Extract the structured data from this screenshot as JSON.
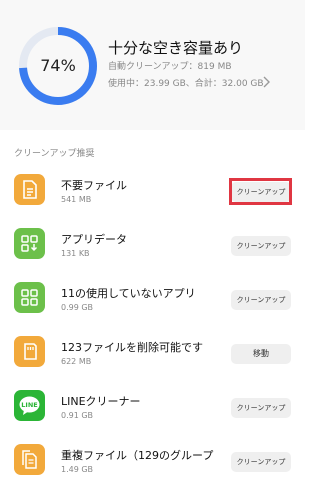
{
  "storage": {
    "percent_label": "74%",
    "percent": 0.74,
    "title": "十分な空き容量あり",
    "auto_cleanup": "自動クリーンアップ：819 MB",
    "usage": "使用中：23.99 GB、合計：32.00 GB",
    "ring_color": "#3a7cf0",
    "ring_track_color": "#e4e9f2"
  },
  "section_title": "クリーンアップ推奨",
  "items": [
    {
      "name": "不要ファイル",
      "size": "541 MB",
      "button": "クリーンアップ",
      "icon": "file-icon",
      "icon_color": "#f2a93b"
    },
    {
      "name": "アプリデータ",
      "size": "131 KB",
      "button": "クリーンアップ",
      "icon": "app-data-icon",
      "icon_color": "#6cc04a"
    },
    {
      "name": "11の使用していないアプリ",
      "size": "0.99 GB",
      "button": "クリーンアップ",
      "icon": "apps-grid-icon",
      "icon_color": "#6cc04a"
    },
    {
      "name": "123ファイルを削除可能です",
      "size": "622 MB",
      "button": "移動",
      "icon": "sd-card-icon",
      "icon_color": "#f2a93b"
    },
    {
      "name": "LINEクリーナー",
      "size": "0.91 GB",
      "button": "クリーンアップ",
      "icon": "line-app-icon",
      "icon_color": "#2bb536",
      "icon_text": "LINE"
    },
    {
      "name": "重複ファイル（129のグループ",
      "size": "1.49 GB",
      "button": "クリーンアップ",
      "icon": "duplicate-file-icon",
      "icon_color": "#f2a93b"
    }
  ],
  "highlight_color": "#e03642"
}
